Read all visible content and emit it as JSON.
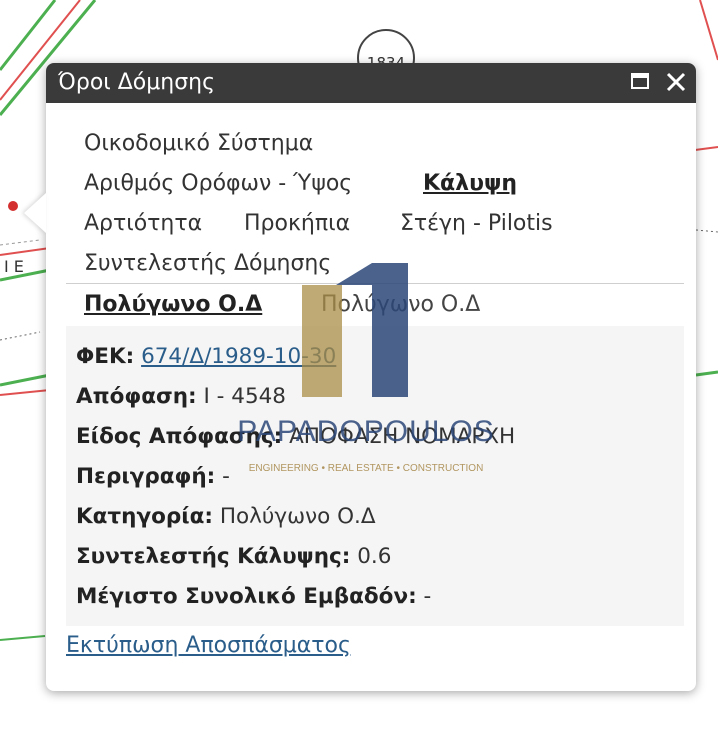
{
  "popup": {
    "title": "Όροι Δόμησης"
  },
  "menu": {
    "item_building_system": "Οικοδομικό Σύστημα",
    "item_floors_height": "Αριθμός Ορόφων - Ύψος",
    "item_coverage": "Κάλυψη",
    "item_plot": "Αρτιότητα",
    "item_setbacks": "Προκήπια",
    "item_roof": "Στέγη - Pilotis",
    "item_building_coefficient": "Συντελεστής Δόμησης"
  },
  "tabs": {
    "active": "Πολύγωνο Ο.Δ",
    "inactive": "Πολύγωνο Ο.Δ"
  },
  "details": {
    "fek_label": "ΦΕΚ:",
    "fek_value": "674/Δ/1989-10-30",
    "decision_label": "Απόφαση:",
    "decision_value": "I - 4548",
    "decision_type_label": "Είδος Απόφασης:",
    "decision_type_value": "ΑΠΟΦΑΣΗ ΝΟΜΑΡΧΗ",
    "description_label": "Περιγραφή:",
    "description_value": "-",
    "category_label": "Κατηγορία:",
    "category_value": "Πολύγωνο Ο.Δ",
    "coverage_coef_label": "Συντελεστής Κάλυψης:",
    "coverage_coef_value": "0.6",
    "max_area_label": "Μέγιστο Συνολικό Εμβαδόν:",
    "max_area_value": "-"
  },
  "footer": {
    "print_link": "Εκτύπωση Αποσπάσματος"
  },
  "watermark": {
    "brand": "PAPADOPOULOS",
    "tagline": "ENGINEERING • REAL ESTATE • CONSTRUCTION"
  },
  "map": {
    "parcel_label": "1834",
    "line_color": "#e05050",
    "road_color": "#4caf50"
  }
}
